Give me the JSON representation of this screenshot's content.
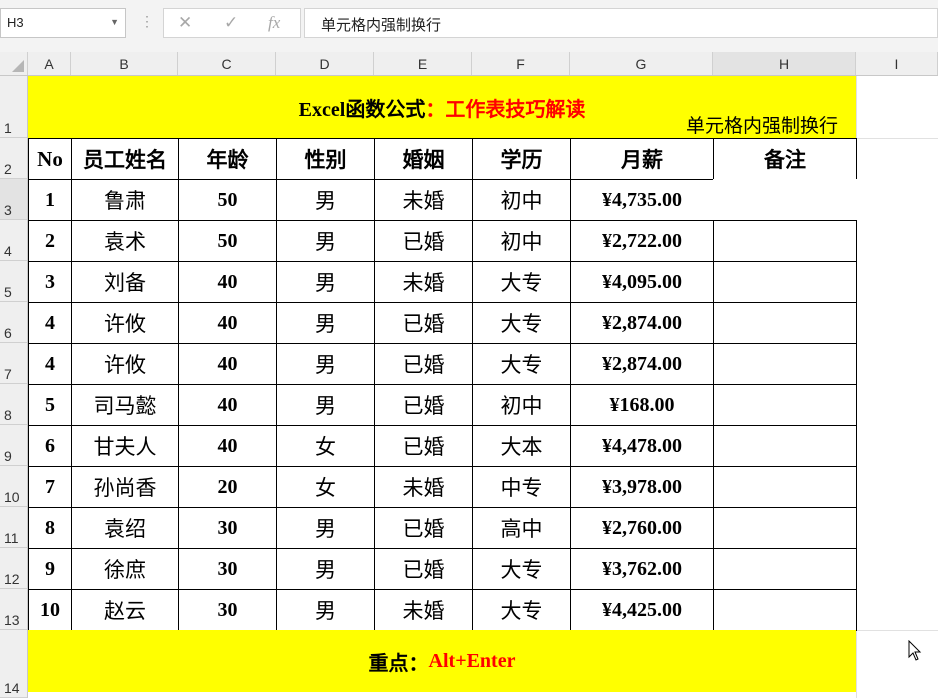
{
  "name_box": {
    "value": "H3"
  },
  "formula_bar": {
    "cancel_icon": "close-icon",
    "enter_icon": "check-icon",
    "fx_label": "fx",
    "content": "单元格内强制换行"
  },
  "columns": [
    "A",
    "B",
    "C",
    "D",
    "E",
    "F",
    "G",
    "H",
    "I"
  ],
  "rows": [
    "1",
    "2",
    "3",
    "4",
    "5",
    "6",
    "7",
    "8",
    "9",
    "10",
    "11",
    "12",
    "13",
    "14"
  ],
  "sheet": {
    "title_black": "Excel函数公式",
    "title_red": "：工作表技巧解读",
    "headers": [
      "No",
      "员工姓名",
      "年龄",
      "性别",
      "婚姻",
      "学历",
      "月薪",
      "备注"
    ],
    "records": [
      [
        "1",
        "鲁肃",
        "50",
        "男",
        "未婚",
        "初中",
        "¥4,735.00",
        "单元格内强制换行"
      ],
      [
        "2",
        "袁术",
        "50",
        "男",
        "已婚",
        "初中",
        "¥2,722.00",
        ""
      ],
      [
        "3",
        "刘备",
        "40",
        "男",
        "未婚",
        "大专",
        "¥4,095.00",
        ""
      ],
      [
        "4",
        "许攸",
        "40",
        "男",
        "已婚",
        "大专",
        "¥2,874.00",
        ""
      ],
      [
        "4",
        "许攸",
        "40",
        "男",
        "已婚",
        "大专",
        "¥2,874.00",
        ""
      ],
      [
        "5",
        "司马懿",
        "40",
        "男",
        "已婚",
        "初中",
        "¥168.00",
        ""
      ],
      [
        "6",
        "甘夫人",
        "40",
        "女",
        "已婚",
        "大本",
        "¥4,478.00",
        ""
      ],
      [
        "7",
        "孙尚香",
        "20",
        "女",
        "未婚",
        "中专",
        "¥3,978.00",
        ""
      ],
      [
        "8",
        "袁绍",
        "30",
        "男",
        "已婚",
        "高中",
        "¥2,760.00",
        ""
      ],
      [
        "9",
        "徐庶",
        "30",
        "男",
        "已婚",
        "大专",
        "¥3,762.00",
        ""
      ],
      [
        "10",
        "赵云",
        "30",
        "男",
        "未婚",
        "大专",
        "¥4,425.00",
        ""
      ]
    ],
    "footer_black": "重点：",
    "footer_red": "Alt+Enter"
  },
  "colors": {
    "banner": "#ffff00",
    "accent_red": "#ff0000"
  }
}
